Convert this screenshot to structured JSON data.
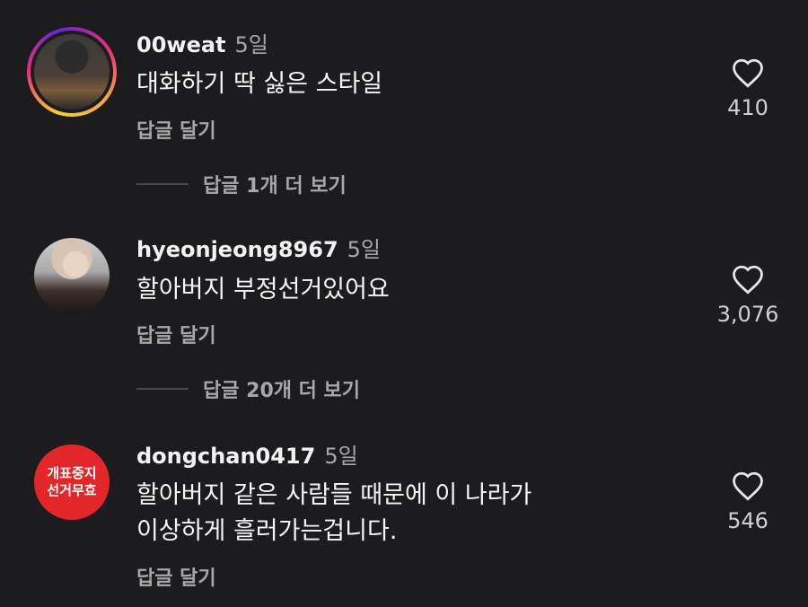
{
  "comments": [
    {
      "username": "00weat",
      "time": "5일",
      "lines": [
        "대화하기 딱 싫은 스타일"
      ],
      "reply_label": "답글 달기",
      "likes": "410",
      "avatar": "story-ring-photo"
    },
    {
      "username": "hyeonjeong8967",
      "time": "5일",
      "lines": [
        "할아버지 부정선거있어요"
      ],
      "reply_label": "답글 달기",
      "likes": "3,076",
      "avatar": "photo"
    },
    {
      "username": "dongchan0417",
      "time": "5일",
      "lines": [
        "할아버지 같은 사람들 때문에 이 나라가",
        "이상하게 흘러가는겁니다."
      ],
      "reply_label": "답글 달기",
      "likes": "546",
      "avatar": "badge",
      "badge_lines": [
        "개표중지",
        "선거무효"
      ]
    }
  ],
  "view_more": [
    {
      "label": "답글 1개 더 보기"
    },
    {
      "label": "답글 20개 더 보기"
    }
  ],
  "icons": {
    "like": "heart-outline-icon"
  },
  "colors": {
    "background": "#1c1c1e",
    "badge": "#e3262a",
    "secondary_text": "#a8a8a8"
  }
}
